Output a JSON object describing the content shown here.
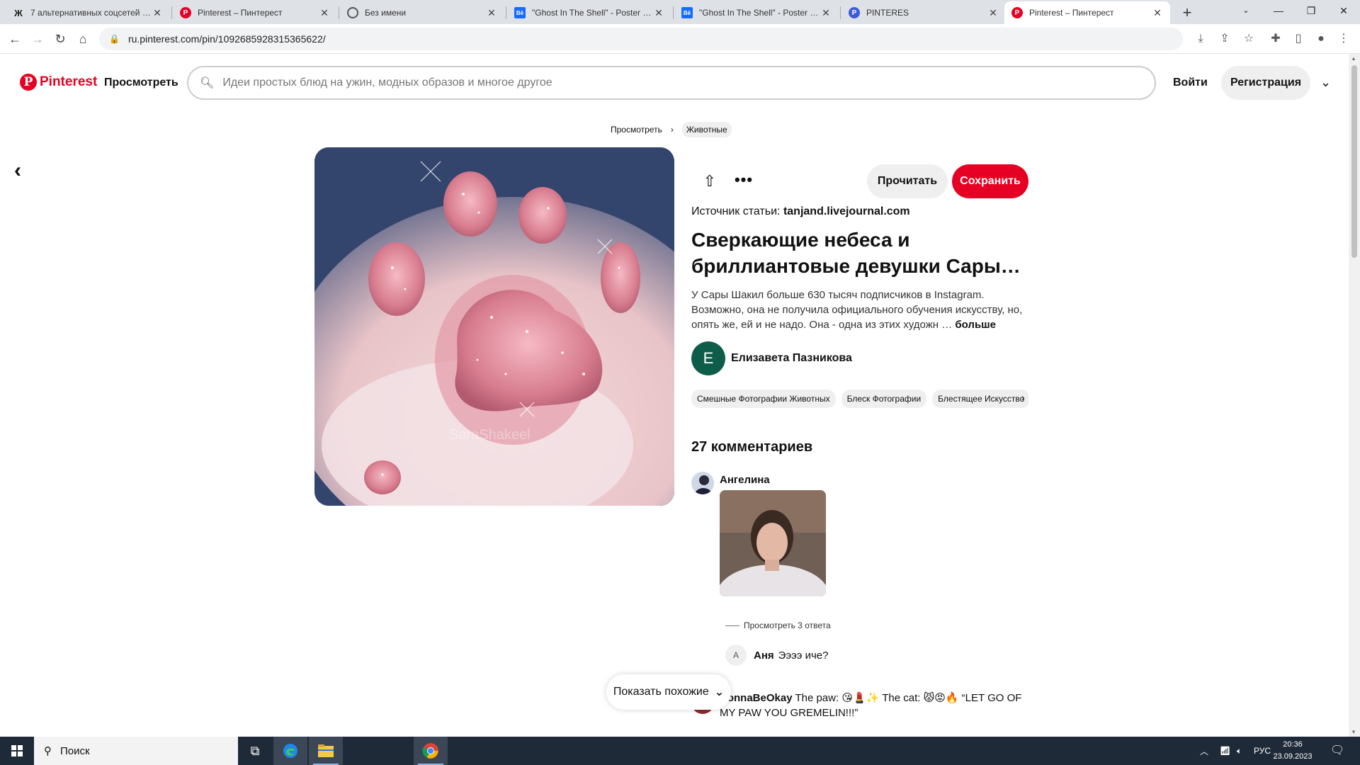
{
  "browser": {
    "tabs": [
      {
        "title": "7 альтернативных соцсетей для",
        "favicon": "z-letter-icon"
      },
      {
        "title": "Pinterest – Пинтерест",
        "favicon": "pinterest-icon"
      },
      {
        "title": "Без имени",
        "favicon": "globe-icon"
      },
      {
        "title": "\"Ghost In The Shell\" - Poster Pos",
        "favicon": "behance-icon"
      },
      {
        "title": "\"Ghost In The Shell\" - Poster Pos",
        "favicon": "behance-icon"
      },
      {
        "title": "PINTERES",
        "favicon": "pinterest-icon"
      },
      {
        "title": "Pinterest – Пинтерест",
        "favicon": "pinterest-icon",
        "active": true
      }
    ],
    "favicon_letters": {
      "z": "Ж",
      "p": "P",
      "be": "Bē"
    },
    "url": "ru.pinterest.com/pin/1092685928315365622/"
  },
  "header": {
    "logo_text": "Pinterest",
    "logo_letter": "P",
    "explore": "Просмотреть",
    "search_placeholder": "Идеи простых блюд на ужин, модных образов и многое другое",
    "login": "Войти",
    "signup": "Регистрация"
  },
  "breadcrumb": {
    "items": [
      "Просмотреть",
      "Животные"
    ]
  },
  "pin": {
    "watermark": "SaraShakeel",
    "read_label": "Прочитать",
    "save_label": "Сохранить",
    "source_label": "Источник статьи:",
    "source_domain": "tanjand.livejournal.com",
    "title": "Сверкающие небеса и бриллиантовые девушки Сары…",
    "description": "У Сары Шакил больше 630 тысяч подписчиков в Instagram. Возможно, она не получила официального обучения искусству, но, опять же, ей и не надо. Она - одна из этих художн …",
    "more_label": "больше",
    "author_initial": "E",
    "author_name": "Елизавета Пазникова",
    "tags": [
      "Смешные Фотографии Животных",
      "Блеск Фотографии",
      "Блестящее Искусство"
    ]
  },
  "comments": {
    "count_label": "27 комментариев",
    "first": {
      "name": "Ангелина"
    },
    "view_replies": "Просмотреть 3 ответа",
    "reply": {
      "initial": "А",
      "name": "Аня",
      "text": "Ээээ иче?"
    },
    "second": {
      "name": "DonnaBeOkay",
      "text": "The paw: 😘💄✨ The cat: 😾😡🔥 “LET GO OF MY PAW YOU GREMELIN!!!”"
    }
  },
  "show_similar": "Показать похожие",
  "taskbar": {
    "search_placeholder": "Поиск",
    "lang": "РУС",
    "time": "20:36",
    "date": "23.09.2023"
  },
  "colors": {
    "brand": "#e60023",
    "author_avatar": "#0e5c4a"
  }
}
